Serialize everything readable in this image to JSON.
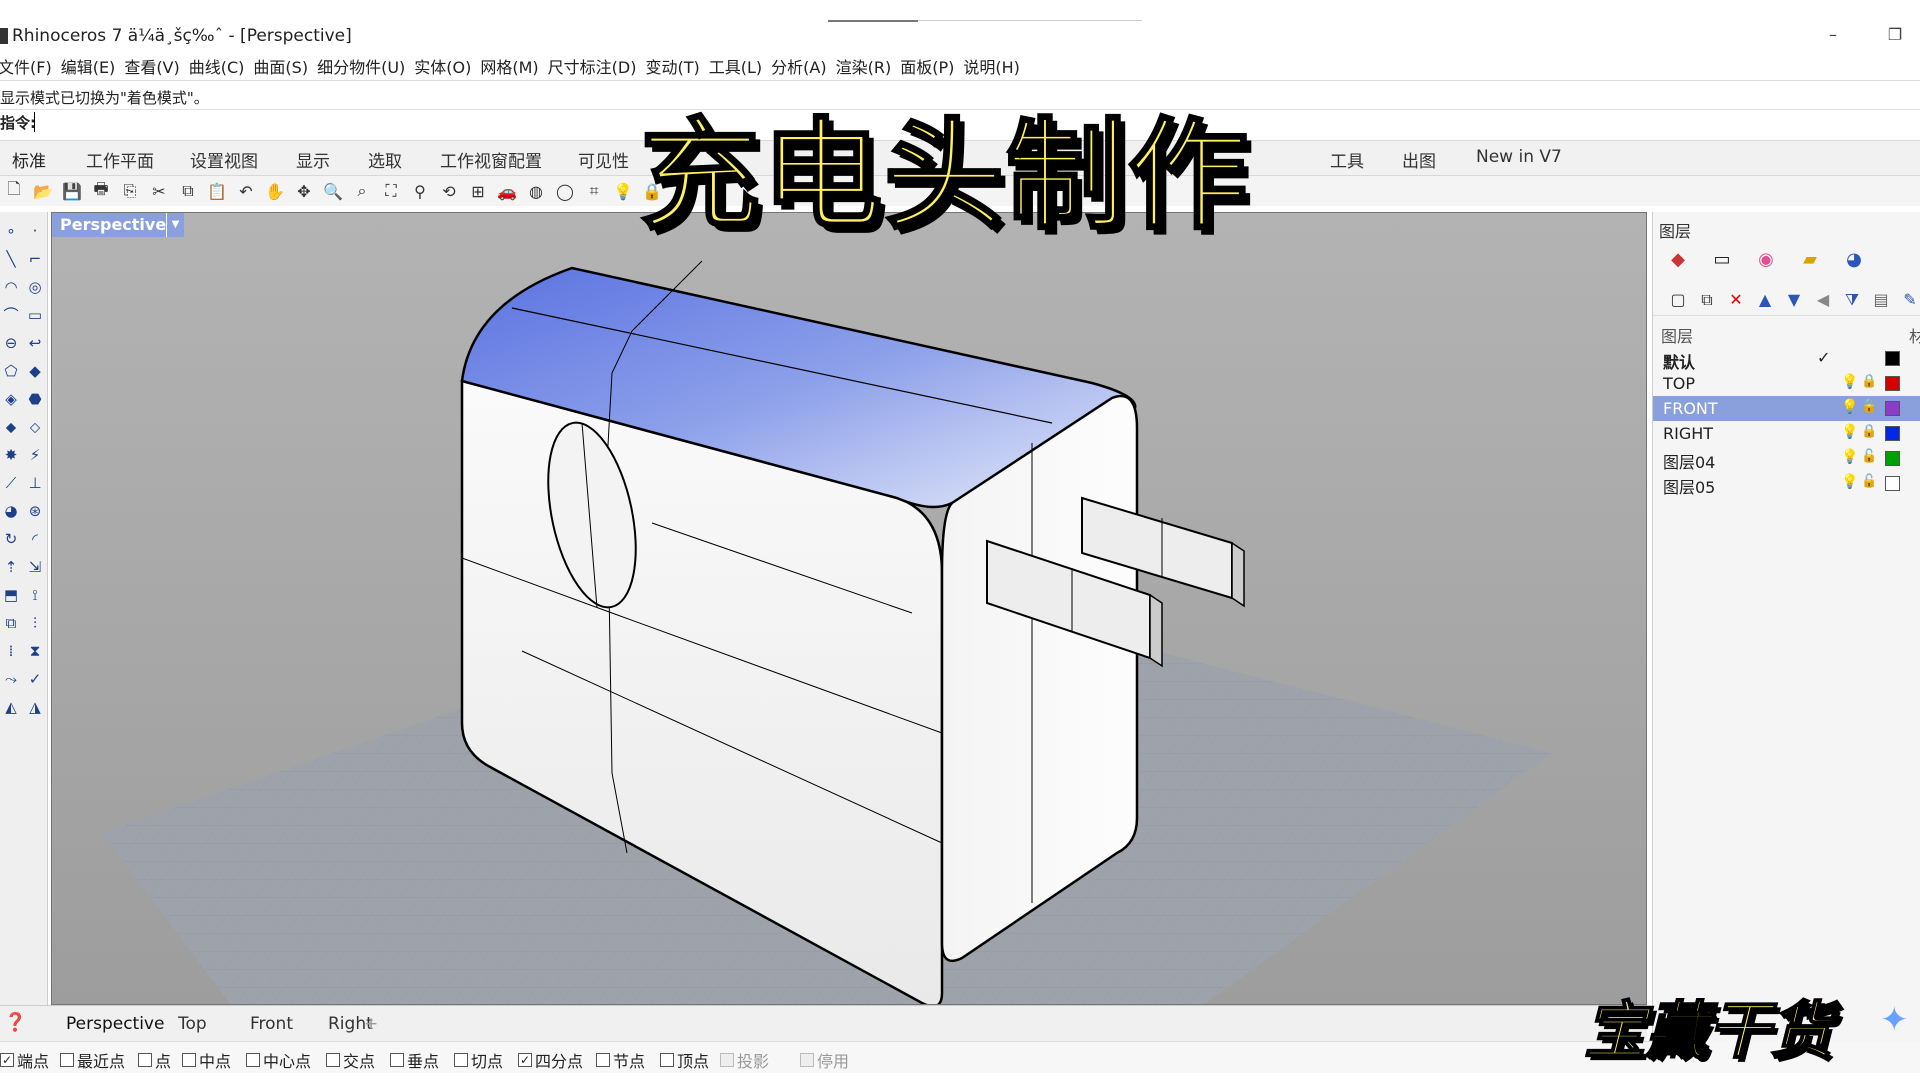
{
  "window": {
    "title": "Rhinoceros 7 ä¼ä¸šç‰ˆ - [Perspective]",
    "minimize_label": "–",
    "restore_label": "❐"
  },
  "menu": [
    "文件(F)",
    "编辑(E)",
    "查看(V)",
    "曲线(C)",
    "曲面(S)",
    "细分物件(U)",
    "实体(O)",
    "网格(M)",
    "尺寸标注(D)",
    "变动(T)",
    "工具(L)",
    "分析(A)",
    "渲染(R)",
    "面板(P)",
    "说明(H)"
  ],
  "command": {
    "history": "显示模式已切换为\"着色模式\"。",
    "prompt": "指令:",
    "value": ""
  },
  "toolbar_tabs": [
    "标准",
    "工作平面",
    "设置视图",
    "显示",
    "选取",
    "工作视窗配置",
    "可见性",
    "工具",
    "出图",
    "New in V7"
  ],
  "toolbar_icons": [
    "new-file-icon",
    "open-icon",
    "save-icon",
    "print-icon",
    "import-icon",
    "cut-icon",
    "copy-icon",
    "paste-icon",
    "undo-icon",
    "pan-hand-icon",
    "move-view-icon",
    "zoom-icon",
    "zoom-window-icon",
    "zoom-extents-icon",
    "zoom-selected-icon",
    "rotate-view-icon",
    "four-viewports-icon",
    "car-icon",
    "render-icon",
    "circle-icon",
    "grid-snap-icon",
    "lightbulb-icon",
    "lock-icon"
  ],
  "viewport": {
    "label": "Perspective",
    "dropdown_icon": "▼",
    "tabs": [
      "Perspective",
      "Top",
      "Front",
      "Right"
    ],
    "add_tab_icon": "+"
  },
  "osnap": [
    {
      "label": "端点",
      "checked": true,
      "disabled": false
    },
    {
      "label": "最近点",
      "checked": false,
      "disabled": false
    },
    {
      "label": "点",
      "checked": false,
      "disabled": false
    },
    {
      "label": "中点",
      "checked": false,
      "disabled": false
    },
    {
      "label": "中心点",
      "checked": false,
      "disabled": false
    },
    {
      "label": "交点",
      "checked": false,
      "disabled": false
    },
    {
      "label": "垂点",
      "checked": false,
      "disabled": false
    },
    {
      "label": "切点",
      "checked": false,
      "disabled": false
    },
    {
      "label": "四分点",
      "checked": true,
      "disabled": false
    },
    {
      "label": "节点",
      "checked": false,
      "disabled": false
    },
    {
      "label": "顶点",
      "checked": false,
      "disabled": false
    },
    {
      "label": "投影",
      "checked": false,
      "disabled": true
    },
    {
      "label": "停用",
      "checked": false,
      "disabled": true
    }
  ],
  "layers_panel": {
    "title": "图层",
    "column_name": "图层",
    "column_material": "材",
    "layers": [
      {
        "name": "默认",
        "current": true,
        "color": "#000000",
        "selected": false,
        "bulb": "",
        "lock": ""
      },
      {
        "name": "TOP",
        "current": false,
        "color": "#d40000",
        "selected": false,
        "bulb": "💡",
        "lock": "🔒"
      },
      {
        "name": "FRONT",
        "current": false,
        "color": "#8c3cc8",
        "selected": true,
        "bulb": "💡",
        "lock": "🔒"
      },
      {
        "name": "RIGHT",
        "current": false,
        "color": "#0028e6",
        "selected": false,
        "bulb": "💡",
        "lock": "🔒"
      },
      {
        "name": "图层04",
        "current": false,
        "color": "#00a000",
        "selected": false,
        "bulb": "💡",
        "lock": "🔓"
      },
      {
        "name": "图层05",
        "current": false,
        "color": "#ffffff",
        "selected": false,
        "bulb": "💡",
        "lock": "🔓"
      }
    ]
  },
  "overlay": {
    "title": "充电头制作",
    "subtitle": "宝藏干货",
    "sparkle": "✦"
  },
  "colors": {
    "viewport_label_bg": "#8aa0dc",
    "selected_layer_bg": "#8aa0dc",
    "overlay_text": "#fff060"
  }
}
